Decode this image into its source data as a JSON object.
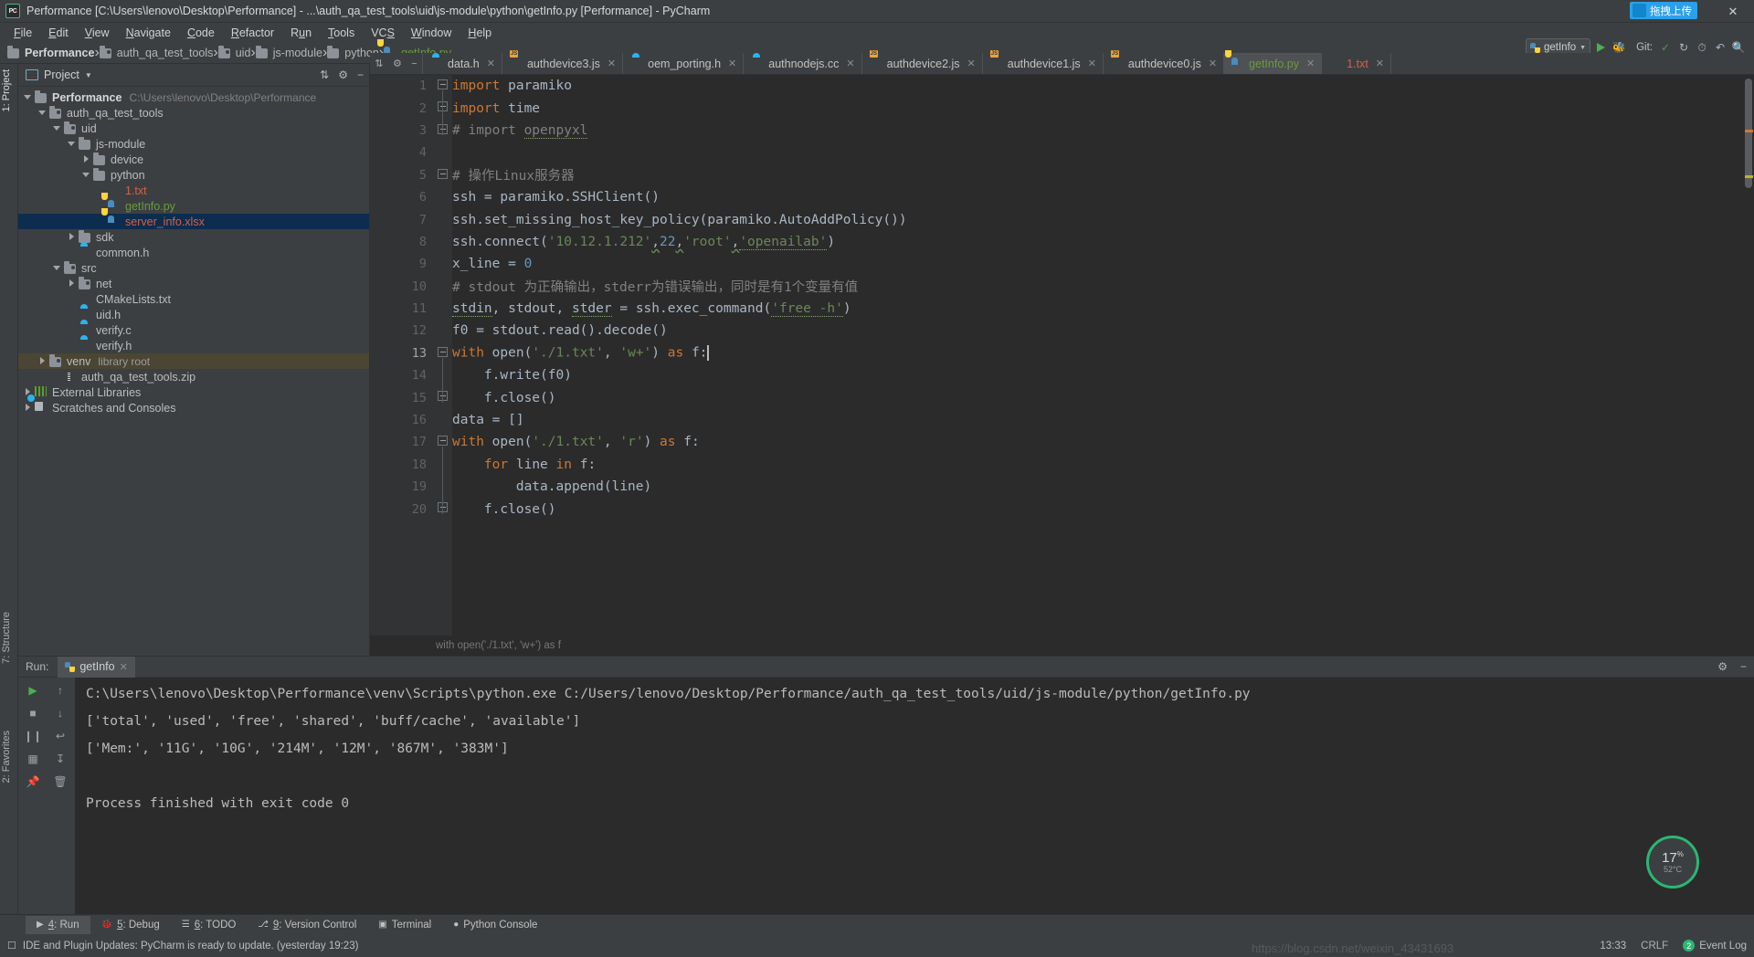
{
  "window": {
    "title": "Performance [C:\\Users\\lenovo\\Desktop\\Performance] - ...\\auth_qa_test_tools\\uid\\js-module\\python\\getInfo.py [Performance] - PyCharm",
    "logo": "PC",
    "minimize": "–",
    "maximize": "☐",
    "close": "✕"
  },
  "menu": [
    "File",
    "Edit",
    "View",
    "Navigate",
    "Code",
    "Refactor",
    "Run",
    "Tools",
    "VCS",
    "Window",
    "Help"
  ],
  "breadcrumb": [
    {
      "label": "Performance",
      "type": "folder",
      "bold": true
    },
    {
      "label": "auth_qa_test_tools",
      "type": "module"
    },
    {
      "label": "uid",
      "type": "module"
    },
    {
      "label": "js-module",
      "type": "folder"
    },
    {
      "label": "python",
      "type": "folder"
    },
    {
      "label": "getInfo.py",
      "type": "python",
      "green": true
    }
  ],
  "toolbar": {
    "upload_label": "拖拽上传",
    "run_config": "getInfo",
    "git_label": "Git:",
    "search_icon": "search-icon"
  },
  "left_strip": [
    "1: Project",
    "7: Structure",
    "2: Favorites"
  ],
  "project_panel": {
    "title": "Project",
    "tree": [
      {
        "indent": 0,
        "arrow": "down",
        "icon": "folder",
        "label": "Performance",
        "bold": true,
        "sub": "C:\\Users\\lenovo\\Desktop\\Performance"
      },
      {
        "indent": 1,
        "arrow": "down",
        "icon": "folder-mod",
        "label": "auth_qa_test_tools"
      },
      {
        "indent": 2,
        "arrow": "down",
        "icon": "folder-mod",
        "label": "uid"
      },
      {
        "indent": 3,
        "arrow": "down",
        "icon": "folder",
        "label": "js-module"
      },
      {
        "indent": 4,
        "arrow": "right",
        "icon": "folder",
        "label": "device"
      },
      {
        "indent": 4,
        "arrow": "down",
        "icon": "folder",
        "label": "python"
      },
      {
        "indent": 5,
        "arrow": "none",
        "icon": "txt",
        "label": "1.txt",
        "color": "red"
      },
      {
        "indent": 5,
        "arrow": "none",
        "icon": "py",
        "label": "getInfo.py",
        "color": "green"
      },
      {
        "indent": 5,
        "arrow": "none",
        "icon": "py",
        "label": "server_info.xlsx",
        "color": "red",
        "selected": true
      },
      {
        "indent": 3,
        "arrow": "right",
        "icon": "folder",
        "label": "sdk"
      },
      {
        "indent": 3,
        "arrow": "none",
        "icon": "ch",
        "label": "common.h"
      },
      {
        "indent": 2,
        "arrow": "down",
        "icon": "folder-mod",
        "label": "src"
      },
      {
        "indent": 3,
        "arrow": "right",
        "icon": "folder-mod",
        "label": "net"
      },
      {
        "indent": 3,
        "arrow": "none",
        "icon": "txt",
        "label": "CMakeLists.txt"
      },
      {
        "indent": 3,
        "arrow": "none",
        "icon": "ch",
        "label": "uid.h"
      },
      {
        "indent": 3,
        "arrow": "none",
        "icon": "ch",
        "label": "verify.c"
      },
      {
        "indent": 3,
        "arrow": "none",
        "icon": "ch",
        "label": "verify.h"
      },
      {
        "indent": 1,
        "arrow": "right",
        "icon": "folder-mod",
        "label": "venv",
        "sub": "library root",
        "highlight": true
      },
      {
        "indent": 2,
        "arrow": "none",
        "icon": "zip",
        "label": "auth_qa_test_tools.zip"
      },
      {
        "indent": 0,
        "arrow": "right",
        "icon": "lib",
        "label": "External Libraries"
      },
      {
        "indent": 0,
        "arrow": "right",
        "icon": "scratch",
        "label": "Scratches and Consoles"
      }
    ]
  },
  "editor": {
    "tabs": [
      {
        "label": "data.h",
        "icon": "ch"
      },
      {
        "label": "authdevice3.js",
        "icon": "js"
      },
      {
        "label": "oem_porting.h",
        "icon": "ch"
      },
      {
        "label": "authnodejs.cc",
        "icon": "ch"
      },
      {
        "label": "authdevice2.js",
        "icon": "js"
      },
      {
        "label": "authdevice1.js",
        "icon": "js"
      },
      {
        "label": "authdevice0.js",
        "icon": "js"
      },
      {
        "label": "getInfo.py",
        "icon": "py",
        "color": "green",
        "active": true
      },
      {
        "label": "1.txt",
        "icon": "txt",
        "color": "red"
      }
    ],
    "hint": "with open('./1.txt', 'w+') as f",
    "lines": [
      {
        "n": 1,
        "fold": "arrow",
        "html": "<span class='kw'>import</span> paramiko"
      },
      {
        "n": 2,
        "fold": "box",
        "html": "<span class='kw'>import</span> time"
      },
      {
        "n": 3,
        "fold": "arrow",
        "html": "<span class='cmt'># import </span><span class='cmt errg'>openpyxl</span>"
      },
      {
        "n": 4,
        "fold": "",
        "html": ""
      },
      {
        "n": 5,
        "fold": "boxend",
        "html": "<span class='cmt'># 操作Linux服务器</span>"
      },
      {
        "n": 6,
        "fold": "",
        "html": "ssh = paramiko.SSHClient()"
      },
      {
        "n": 7,
        "fold": "",
        "html": "ssh.set_missing_host_key_policy(paramiko.AutoAddPolicy())"
      },
      {
        "n": 8,
        "fold": "",
        "html": "ssh.connect(<span class='str'>'10.12.1.212'</span><span class='err'>,</span><span class='num'>22</span><span class='err'>,</span><span class='str'>'root'</span><span class='err'>,</span><span class='str errg'>'openailab'</span>)"
      },
      {
        "n": 9,
        "fold": "",
        "html": "x_line = <span class='num'>0</span>"
      },
      {
        "n": 10,
        "fold": "",
        "html": "<span class='cmt'># stdout 为正确输出，stderr为错误输出，同时是有1个变量有值</span>"
      },
      {
        "n": 11,
        "fold": "",
        "html": "<span class='errg'>stdin</span>, stdout, <span class='errg'>stder</span> = ssh.exec_command(<span class='str errg'>'free -h'</span>)"
      },
      {
        "n": 12,
        "fold": "",
        "html": "f0 = stdout.read().decode()"
      },
      {
        "n": 13,
        "fold": "arrow",
        "html": "<span class='kw'>with</span> open(<span class='str'>'./1.txt'</span>, <span class='str'>'w+'</span>) <span class='kw'>as</span> f:<span class='cursor'></span>",
        "current": true
      },
      {
        "n": 14,
        "fold": "",
        "html": "    f.write(f0)"
      },
      {
        "n": 15,
        "fold": "boxend",
        "html": "    f.close()"
      },
      {
        "n": 16,
        "fold": "",
        "html": "data = []"
      },
      {
        "n": 17,
        "fold": "arrow",
        "html": "<span class='kw'>with</span> open(<span class='str'>'./1.txt'</span>, <span class='str'>'r'</span>) <span class='kw'>as</span> f:"
      },
      {
        "n": 18,
        "fold": "",
        "html": "    <span class='kw'>for</span> line <span class='kw'>in</span> f:"
      },
      {
        "n": 19,
        "fold": "",
        "html": "        data.append(line)"
      },
      {
        "n": 20,
        "fold": "boxend",
        "html": "    f.close()"
      }
    ]
  },
  "run_panel": {
    "label": "Run:",
    "tab": "getInfo",
    "console": [
      "C:\\Users\\lenovo\\Desktop\\Performance\\venv\\Scripts\\python.exe C:/Users/lenovo/Desktop/Performance/auth_qa_test_tools/uid/js-module/python/getInfo.py",
      "['total', 'used', 'free', 'shared', 'buff/cache', 'available']",
      "['Mem:', '11G', '10G', '214M', '12M', '867M', '383M']",
      "",
      "Process finished with exit code 0"
    ]
  },
  "gauge": {
    "percent": "17",
    "unit": "%",
    "temp": "52°C"
  },
  "tool_windows": [
    {
      "key": "4",
      "label": "Run",
      "icon": "play-icon",
      "active": true
    },
    {
      "key": "5",
      "label": "Debug",
      "icon": "bug-icon"
    },
    {
      "key": "6",
      "label": "TODO",
      "icon": "list-icon"
    },
    {
      "key": "9",
      "label": "Version Control",
      "icon": "branch-icon"
    },
    {
      "key": "",
      "label": "Terminal",
      "icon": "terminal-icon"
    },
    {
      "key": "",
      "label": "Python Console",
      "icon": "python-icon"
    }
  ],
  "status_bar": {
    "message": "IDE and Plugin Updates: PyCharm is ready to update. (yesterday 19:23)",
    "time": "13:33",
    "line_ending": "CRLF",
    "event_log": "Event Log",
    "event_count": "2",
    "watermark": "https://blog.csdn.net/weixin_43431693"
  },
  "colors": {
    "accent_green": "#6a9a3e",
    "accent_red": "#d4604a",
    "selection_blue": "#0d2d4e",
    "panel_bg": "#3c3f41",
    "editor_bg": "#2b2b2b",
    "gauge_green": "#2bb673"
  }
}
